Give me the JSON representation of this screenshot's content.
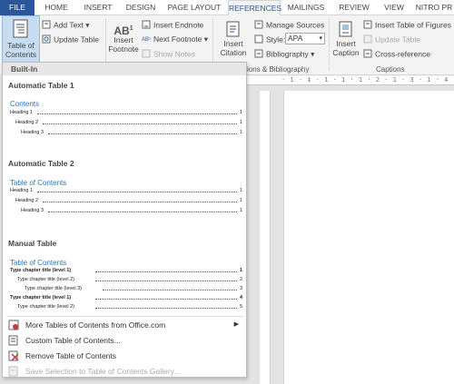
{
  "tabs": [
    {
      "label": "FILE"
    },
    {
      "label": "HOME"
    },
    {
      "label": "INSERT"
    },
    {
      "label": "DESIGN"
    },
    {
      "label": "PAGE LAYOUT"
    },
    {
      "label": "REFERENCES"
    },
    {
      "label": "MAILINGS"
    },
    {
      "label": "REVIEW"
    },
    {
      "label": "VIEW"
    },
    {
      "label": "NITRO PR"
    }
  ],
  "ribbon": {
    "toc": {
      "line1": "Table of",
      "line2": "Contents"
    },
    "add_text": "Add Text",
    "update_table": "Update Table",
    "insert_footnote": {
      "line1": "Insert",
      "line2": "Footnote"
    },
    "insert_endnote": "Insert Endnote",
    "next_footnote": "Next Footnote",
    "show_notes": "Show Notes",
    "insert_citation": {
      "line1": "Insert",
      "line2": "Citation"
    },
    "manage_sources": "Manage Sources",
    "style_label": "Style:",
    "style_value": "APA",
    "bibliography": "Bibliography",
    "group_citations": "ions & Bibliography",
    "insert_caption": {
      "line1": "Insert",
      "line2": "Caption"
    },
    "insert_table_of_figures": "Insert Table of Figures",
    "update_table_2": "Update Table",
    "cross_reference": "Cross-reference",
    "group_captions": "Captions"
  },
  "ruler_text": "· 1 · ‡ · 1 · 1 · 1 · 2 · 1 · 3 · 1 · 4",
  "dropdown": {
    "header": "Built-In",
    "auto1": {
      "section": "Automatic Table 1",
      "title": "Contents",
      "entries": [
        {
          "text": "Heading 1",
          "num": "1"
        },
        {
          "text": "Heading 2",
          "num": "1"
        },
        {
          "text": "Heading 3",
          "num": "1"
        }
      ]
    },
    "auto2": {
      "section": "Automatic Table 2",
      "title": "Table of Contents",
      "entries": [
        {
          "text": "Heading 1",
          "num": "1"
        },
        {
          "text": "Heading 2",
          "num": "1"
        },
        {
          "text": "Heading 3",
          "num": "1"
        }
      ]
    },
    "manual": {
      "section": "Manual Table",
      "title": "Table of Contents",
      "entries": [
        {
          "text": "Type chapter title (level 1)",
          "num": "1"
        },
        {
          "text": "Type chapter title (level 2)",
          "num": "2"
        },
        {
          "text": "Type chapter title (level 3)",
          "num": "3"
        },
        {
          "text": "Type chapter title (level 1)",
          "num": "4"
        },
        {
          "text": "Type chapter title (level 2)",
          "num": "5"
        }
      ]
    },
    "menu": [
      {
        "label": "More Tables of Contents from Office.com"
      },
      {
        "label": "Custom Table of Contents..."
      },
      {
        "label": "Remove Table of Contents"
      },
      {
        "label": "Save Selection to Table of Contents Gallery..."
      }
    ]
  }
}
